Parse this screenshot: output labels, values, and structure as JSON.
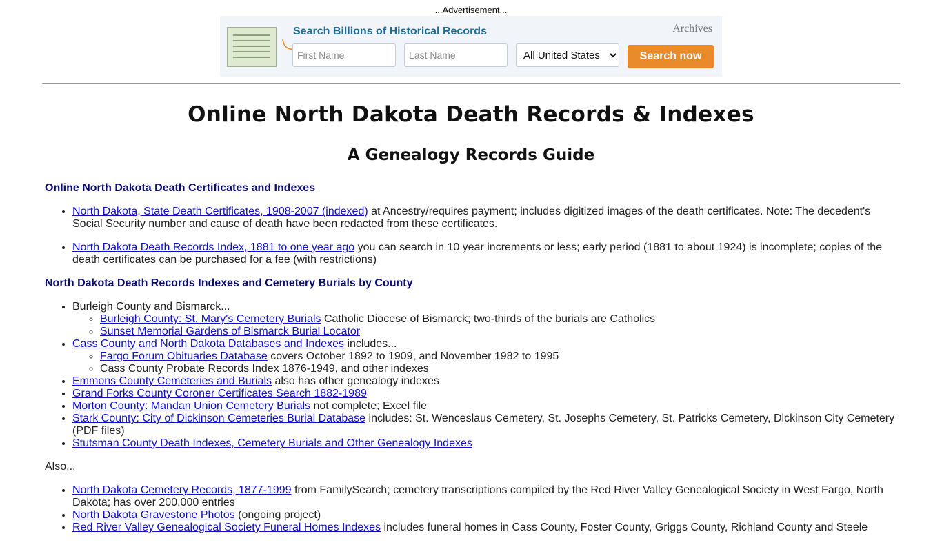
{
  "ad": {
    "label": "...Advertisement...",
    "title": "Search Billions of Historical Records",
    "brand": "Archives",
    "first_name_placeholder": "First Name",
    "last_name_placeholder": "Last Name",
    "location_selected": "All United States",
    "button_label": "Search now"
  },
  "page": {
    "title": "Online North Dakota Death Records & Indexes",
    "subtitle": "A Genealogy Records Guide"
  },
  "sections": {
    "certificates": {
      "heading": "Online North Dakota Death Certificates and Indexes",
      "items": [
        {
          "link": "North Dakota, State Death Certificates, 1908-2007 (indexed)",
          "text": " at Ancestry/requires payment; includes digitized images of the death certificates. Note: The decedent's Social Security number and cause of death have been redacted from these certificates."
        },
        {
          "link": "North Dakota Death Records Index, 1881 to one year ago",
          "text": " you can search in 10 year increments or less; early period (1881 to about 1924) is incomplete; copies of the death certificates can be purchased for a fee (with restrictions)"
        }
      ]
    },
    "county": {
      "heading": "North Dakota Death Records Indexes and Cemetery Burials by County",
      "burleigh_text": "Burleigh County and Bismarck...",
      "burleigh_sub": [
        {
          "link": "Burleigh County: St. Mary's Cemetery Burials",
          "text": " Catholic Diocese of Bismarck; two-thirds of the burials are Catholics"
        },
        {
          "link": "Sunset Memorial Gardens of Bismarck Burial Locator",
          "text": ""
        }
      ],
      "cass": {
        "link": "Cass County and North Dakota Databases and Indexes",
        "text": " includes..."
      },
      "cass_sub": [
        {
          "link": "Fargo Forum Obituaries Database",
          "text": " covers October 1892 to 1909, and November 1982 to 1995"
        },
        {
          "text": "Cass County Probate Records Index 1876-1949, and other indexes"
        }
      ],
      "others": [
        {
          "link": "Emmons County Cemeteries and Burials",
          "text": " also has other genealogy indexes"
        },
        {
          "link": "Grand Forks County Coroner Certificates Search 1882-1989",
          "text": ""
        },
        {
          "link": "Morton County: Mandan Union Cemetery Burials",
          "text": " not complete; Excel file"
        },
        {
          "link": "Stark County: City of Dickinson Cemeteries Burial Database",
          "text": " includes: St. Wenceslaus Cemetery, St. Josephs Cemetery, St. Patricks Cemetery, Dickinson City Cemetery (PDF files)"
        },
        {
          "link": "Stutsman County Death Indexes, Cemetery Burials and Other Genealogy Indexes",
          "text": ""
        }
      ]
    },
    "also": {
      "label": "Also...",
      "items": [
        {
          "link": "North Dakota Cemetery Records, 1877-1999",
          "text": " from FamilySearch; cemetery transcriptions compiled by the Red River Valley Genealogical Society in West Fargo, North Dakota; has over 200,000 entries"
        },
        {
          "link": "North Dakota Gravestone Photos",
          "text": " (ongoing project)"
        },
        {
          "link": "Red River Valley Genealogical Society Funeral Homes Indexes",
          "text": " includes funeral homes in Cass County, Foster County, Griggs County, Richland County and Steele"
        }
      ]
    }
  },
  "colors": {
    "link": "#1010c8",
    "heading": "#0c0e6e",
    "ad_title": "#1f6b91",
    "ad_button": "#e98b2a"
  }
}
